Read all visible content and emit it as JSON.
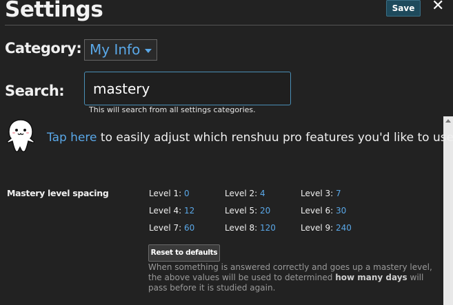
{
  "header": {
    "title": "Settings",
    "save_label": "Save",
    "close_symbol": "✕"
  },
  "category": {
    "label": "Category:",
    "selected": "My Info"
  },
  "search": {
    "label": "Search:",
    "value": "mastery",
    "hint": "This will search from all settings categories."
  },
  "promo": {
    "link_text": "Tap here",
    "rest_text": " to easily adjust which renshuu pro features you'd like to use."
  },
  "mastery": {
    "section_label": "Mastery level spacing",
    "levels": [
      {
        "label": "Level 1: ",
        "value": "0"
      },
      {
        "label": "Level 2: ",
        "value": "4"
      },
      {
        "label": "Level 3: ",
        "value": "7"
      },
      {
        "label": "Level 4: ",
        "value": "12"
      },
      {
        "label": "Level 5: ",
        "value": "20"
      },
      {
        "label": "Level 6: ",
        "value": "30"
      },
      {
        "label": "Level 7: ",
        "value": "60"
      },
      {
        "label": "Level 8: ",
        "value": "120"
      },
      {
        "label": "Level 9: ",
        "value": "240"
      }
    ],
    "reset_label": "Reset to defaults",
    "desc_before": "When something is answered correctly and goes up a mastery level, the above values will be used to determined ",
    "desc_bold": "how many days",
    "desc_after": " will pass before it is studied again."
  },
  "colors": {
    "background": "#222222",
    "accent": "#5aa8e8",
    "save_button": "#1e4a5c"
  }
}
